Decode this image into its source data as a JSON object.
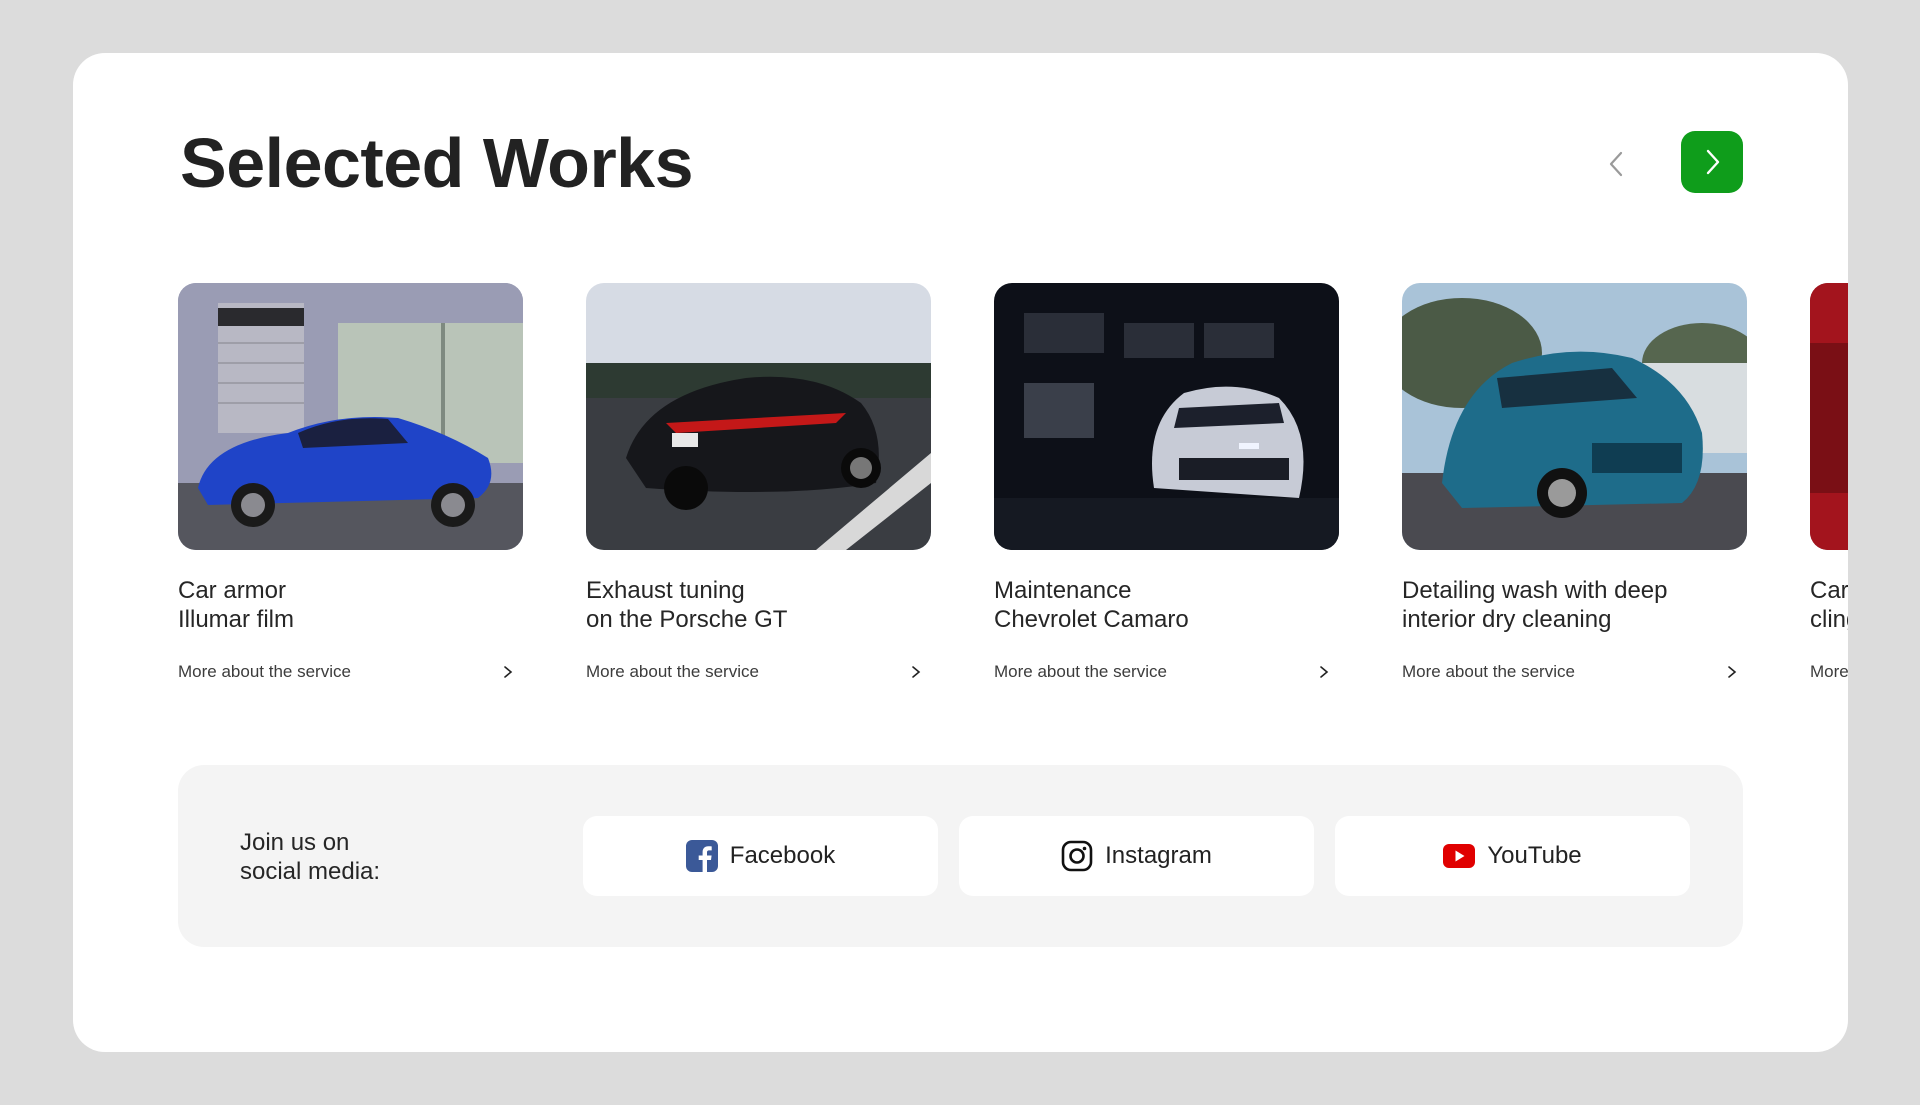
{
  "section": {
    "title": "Selected Works",
    "prev_icon": "chevron-left-icon",
    "next_icon": "chevron-right-icon",
    "accent": "#0f9d1b"
  },
  "works": [
    {
      "line1": "Car armor",
      "line2": "Illumar film",
      "link": "More about the service",
      "image": "blue coupe parked by garage entrance"
    },
    {
      "line1": "Exhaust tuning",
      "line2": "on the Porsche GT",
      "link": "More about the service",
      "image": "black sports sedan on highway"
    },
    {
      "line1": "Maintenance",
      "line2": "Chevrolet Camaro",
      "link": "More about the service",
      "image": "white muscle car in dark garage"
    },
    {
      "line1": "Detailing wash with deep",
      "line2": "interior dry cleaning",
      "link": "More about the service",
      "image": "teal hatchback on street"
    },
    {
      "line1": "Car armor",
      "line2": "cling film",
      "link": "More about the service",
      "image": "red car, partially visible"
    }
  ],
  "social": {
    "label_line1": "Join us on",
    "label_line2": "social media:",
    "facebook": {
      "label": "Facebook",
      "icon": "facebook-icon",
      "color": "#3b5998"
    },
    "instagram": {
      "label": "Instagram",
      "icon": "instagram-icon",
      "color": "#111111"
    },
    "youtube": {
      "label": "YouTube",
      "icon": "youtube-icon",
      "color": "#e00000"
    }
  }
}
